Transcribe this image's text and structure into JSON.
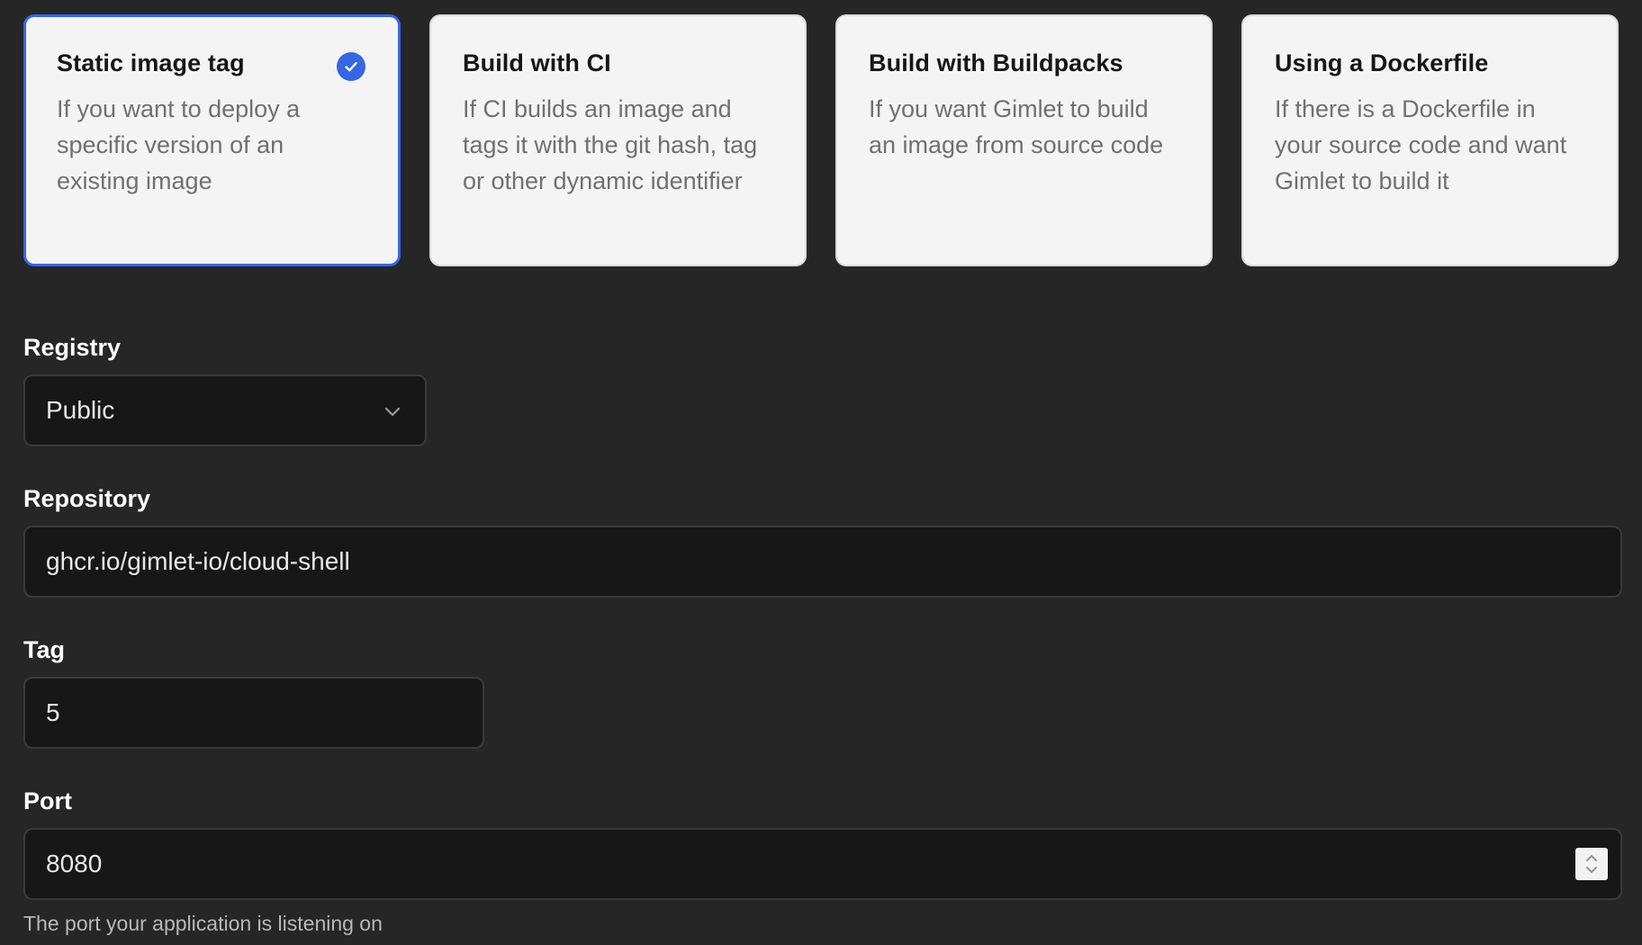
{
  "options": [
    {
      "title": "Static image tag",
      "description": "If you want to deploy a specific version of an existing image",
      "selected": true
    },
    {
      "title": "Build with CI",
      "description": "If CI builds an image and tags it with the git hash, tag or other dynamic identifier",
      "selected": false
    },
    {
      "title": "Build with Buildpacks",
      "description": "If you want Gimlet to build an image from source code",
      "selected": false
    },
    {
      "title": "Using a Dockerfile",
      "description": "If there is a Dockerfile in your source code and want Gimlet to build it",
      "selected": false
    }
  ],
  "form": {
    "registry": {
      "label": "Registry",
      "value": "Public"
    },
    "repository": {
      "label": "Repository",
      "value": "ghcr.io/gimlet-io/cloud-shell"
    },
    "tag": {
      "label": "Tag",
      "value": "5"
    },
    "port": {
      "label": "Port",
      "value": "8080",
      "help": "The port your application is listening on"
    }
  },
  "colors": {
    "accent": "#3766e4",
    "background": "#262626",
    "card_background": "#f4f4f4",
    "input_background": "#171717"
  },
  "icons": {
    "selected": "check-circle-icon",
    "select": "chevron-down-icon",
    "stepper": "stepper-arrows-icon"
  }
}
